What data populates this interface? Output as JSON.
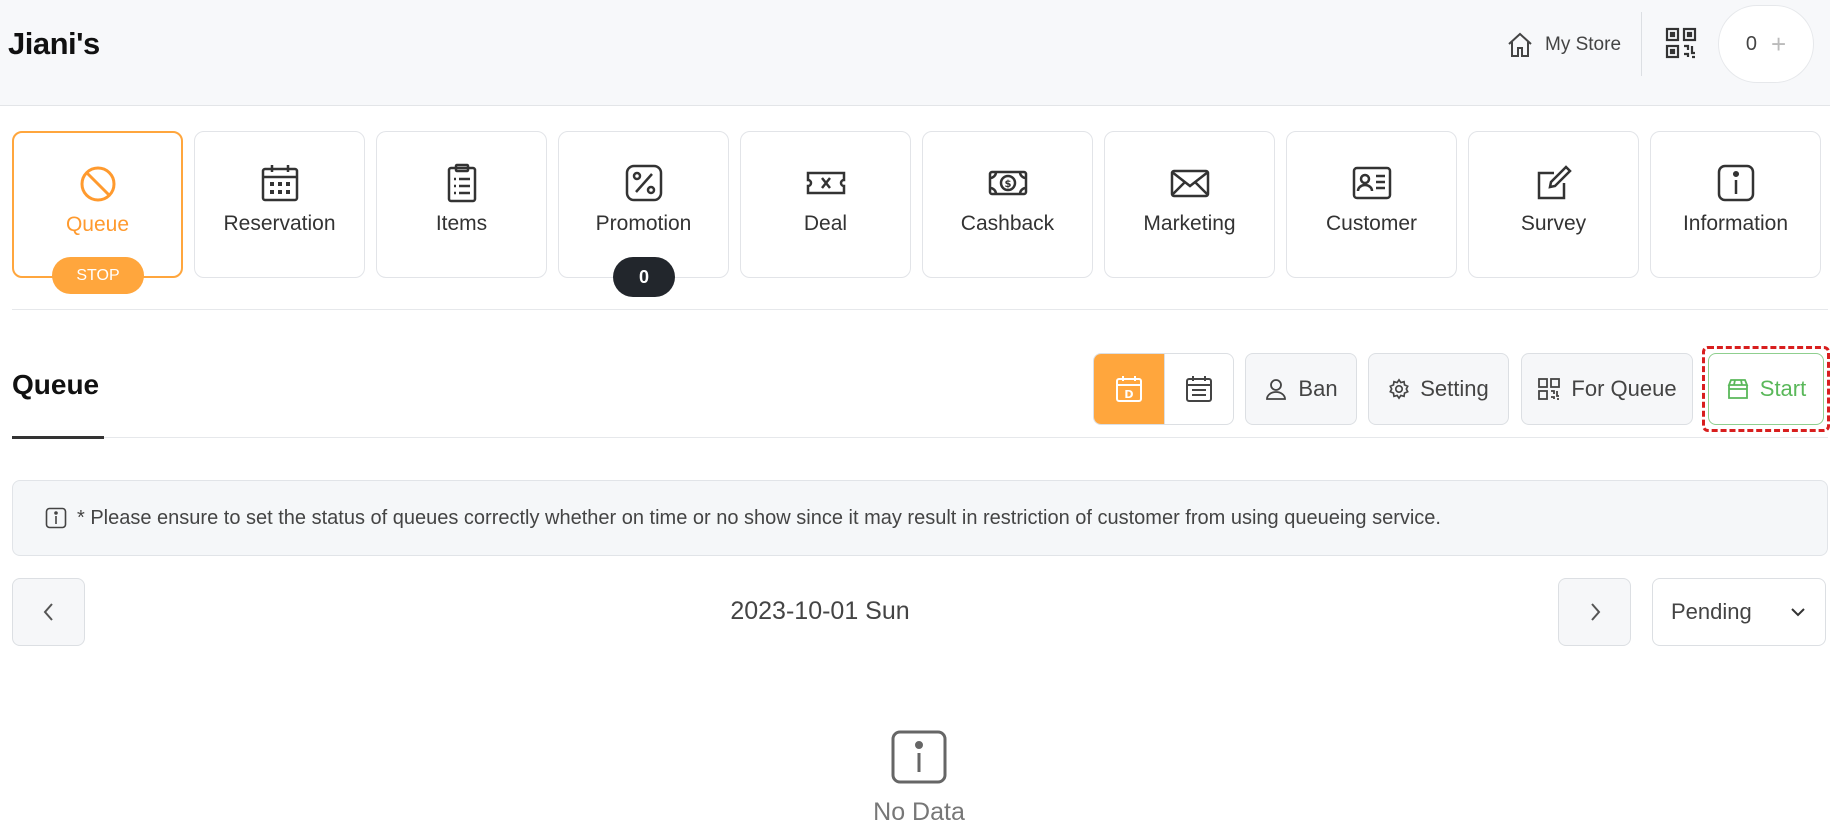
{
  "header": {
    "brand": "Jiani's",
    "my_store_label": "My Store",
    "cart_count": "0",
    "plus_symbol": "+"
  },
  "tiles": [
    {
      "label": "Queue",
      "icon": "ban-icon",
      "active": true
    },
    {
      "label": "Reservation",
      "icon": "calendar-icon"
    },
    {
      "label": "Items",
      "icon": "clipboard-list-icon"
    },
    {
      "label": "Promotion",
      "icon": "percent-icon"
    },
    {
      "label": "Deal",
      "icon": "ticket-icon"
    },
    {
      "label": "Cashback",
      "icon": "money-icon"
    },
    {
      "label": "Marketing",
      "icon": "envelope-icon"
    },
    {
      "label": "Customer",
      "icon": "id-card-icon"
    },
    {
      "label": "Survey",
      "icon": "edit-icon"
    },
    {
      "label": "Information",
      "icon": "info-icon"
    }
  ],
  "badges": {
    "queue_status": "STOP",
    "promotion_count": "0"
  },
  "section": {
    "title": "Queue",
    "ban_label": "Ban",
    "setting_label": "Setting",
    "for_queue_label": "For Queue",
    "start_label": "Start"
  },
  "notice": "* Please ensure to set the status of queues correctly whether on time or no show since it may result in restriction of customer from using queueing service.",
  "date_nav": {
    "date": "2023-10-01 Sun",
    "status_selected": "Pending"
  },
  "empty_state": {
    "label": "No Data"
  },
  "colors": {
    "accent": "#ffa63d",
    "start_green": "#5ab85a",
    "highlight_red": "#d81e1e",
    "badge_dark": "#22262c"
  }
}
